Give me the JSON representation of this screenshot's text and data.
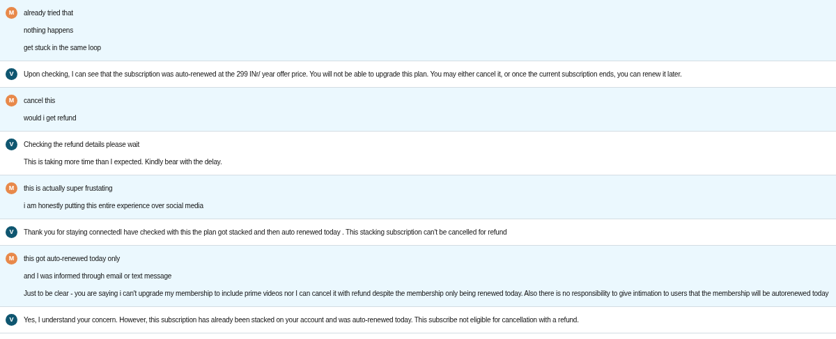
{
  "messages": [
    {
      "kind": "customer",
      "avatar": "M",
      "lines": [
        "already tried that",
        "nothing happens",
        "get stuck in the same loop"
      ]
    },
    {
      "kind": "agent",
      "avatar": "V",
      "lines": [
        "Upon checking, I can see that the subscription was auto-renewed at the 299 INr/ year offer price. You will not be able to upgrade this plan. You may either cancel it, or once the current subscription ends, you can renew it later."
      ]
    },
    {
      "kind": "customer",
      "avatar": "M",
      "lines": [
        "cancel this",
        "would i get refund"
      ]
    },
    {
      "kind": "agent",
      "avatar": "V",
      "lines": [
        "Checking the refund details please wait",
        "This is taking more time than I expected. Kindly bear with the delay."
      ]
    },
    {
      "kind": "customer",
      "avatar": "M",
      "lines": [
        "this is actually super frustating",
        "i am honestly putting this entire experience over social media"
      ]
    },
    {
      "kind": "agent",
      "avatar": "V",
      "lines": [
        "Thank you for staying connectedI have checked with this the plan got stacked and then auto renewed today . This stacking subscription can't be cancelled for refund"
      ]
    },
    {
      "kind": "customer",
      "avatar": "M",
      "lines": [
        "this got auto-renewed today only",
        "and I was informed through email or text message",
        "Just to be clear - you are saying i can't upgrade my membership to include prime videos nor I can cancel it with refund despite the membership only being renewed today. Also there is no responsibility to give intimation to users that the membership will be autorenewed today"
      ]
    },
    {
      "kind": "agent",
      "avatar": "V",
      "lines": [
        "Yes, I understand your concern. However, this subscription has already been stacked on your account and was auto-renewed today. This subscribe not eligible for cancellation with a refund."
      ]
    }
  ]
}
